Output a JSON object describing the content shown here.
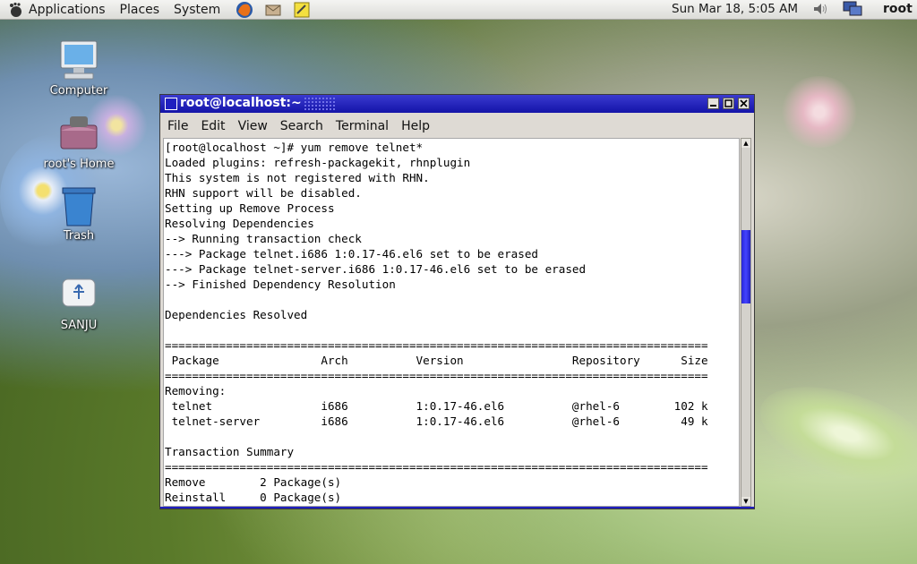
{
  "panel": {
    "menus": [
      "Applications",
      "Places",
      "System"
    ],
    "launchers": [
      "firefox-icon",
      "evolution-icon",
      "notes-icon"
    ],
    "clock": "Sun Mar 18,  5:05 AM",
    "user": "root"
  },
  "desktop": {
    "icons": [
      {
        "label": "Computer",
        "icon": "computer-icon"
      },
      {
        "label": "root's Home",
        "icon": "home-folder-icon"
      },
      {
        "label": "Trash",
        "icon": "trash-icon"
      },
      {
        "label": "SANJU",
        "icon": "usb-drive-icon"
      }
    ]
  },
  "window": {
    "title": "root@localhost:~",
    "menu": [
      {
        "label": "File"
      },
      {
        "label": "Edit"
      },
      {
        "label": "View"
      },
      {
        "label": "Search"
      },
      {
        "label": "Terminal"
      },
      {
        "label": "Help"
      }
    ],
    "terminal_lines": [
      "[root@localhost ~]# yum remove telnet*",
      "Loaded plugins: refresh-packagekit, rhnplugin",
      "This system is not registered with RHN.",
      "RHN support will be disabled.",
      "Setting up Remove Process",
      "Resolving Dependencies",
      "--> Running transaction check",
      "---> Package telnet.i686 1:0.17-46.el6 set to be erased",
      "---> Package telnet-server.i686 1:0.17-46.el6 set to be erased",
      "--> Finished Dependency Resolution",
      "",
      "Dependencies Resolved",
      "",
      "================================================================================",
      " Package               Arch          Version                Repository      Size",
      "================================================================================",
      "Removing:",
      " telnet                i686          1:0.17-46.el6          @rhel-6        102 k",
      " telnet-server         i686          1:0.17-46.el6          @rhel-6         49 k",
      "",
      "Transaction Summary",
      "================================================================================",
      "Remove        2 Package(s)",
      "Reinstall     0 Package(s)"
    ]
  }
}
